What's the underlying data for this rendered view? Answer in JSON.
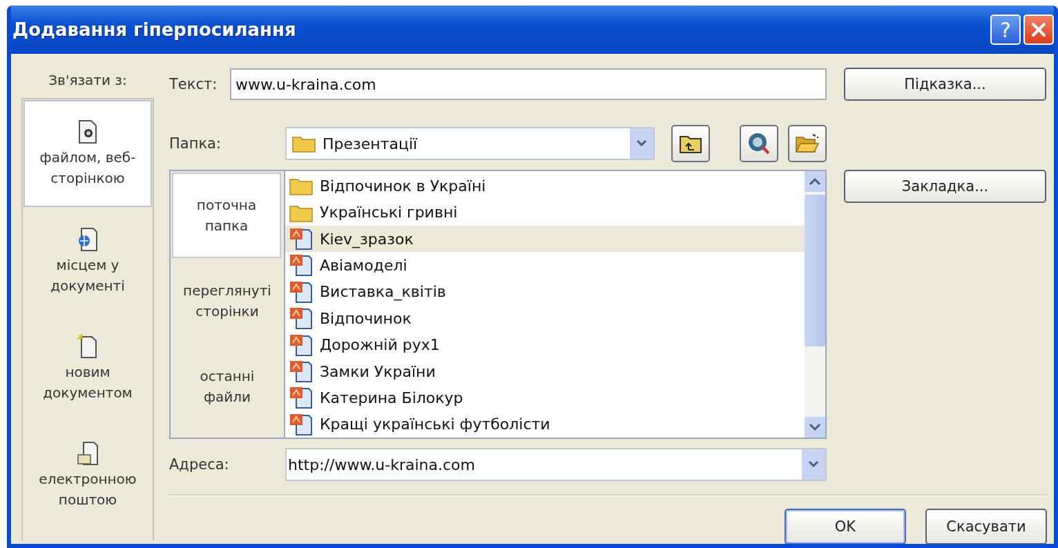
{
  "window": {
    "title": "Додавання гіперпосилання",
    "help": "?"
  },
  "link_to": {
    "label": "Зв'язати з:",
    "items": [
      {
        "label": "файлом, веб-сторінкою",
        "kind": "file",
        "selected": true
      },
      {
        "label": "місцем у документі",
        "kind": "place",
        "selected": false
      },
      {
        "label": "новим документом",
        "kind": "new",
        "selected": false
      },
      {
        "label": "електронною поштою",
        "kind": "email",
        "selected": false
      }
    ]
  },
  "text_field": {
    "label": "Текст:",
    "value": "www.u-kraina.com"
  },
  "folder": {
    "label": "Папка:",
    "value": "Презентації"
  },
  "browse_nav": [
    {
      "label": "поточна папка",
      "selected": true
    },
    {
      "label": "переглянуті сторінки",
      "selected": false
    },
    {
      "label": "останні файли",
      "selected": false
    }
  ],
  "files": [
    {
      "name": "Відпочинок в Україні",
      "kind": "folder",
      "selected": false
    },
    {
      "name": "Українські гривні",
      "kind": "folder",
      "selected": false
    },
    {
      "name": "Kiev_зразок",
      "kind": "presentation",
      "selected": true
    },
    {
      "name": "Авіамоделі",
      "kind": "presentation",
      "selected": false
    },
    {
      "name": "Виставка_квітів",
      "kind": "presentation",
      "selected": false
    },
    {
      "name": "Відпочинок",
      "kind": "presentation",
      "selected": false
    },
    {
      "name": "Дорожній рух1",
      "kind": "presentation",
      "selected": false
    },
    {
      "name": "Замки України",
      "kind": "presentation",
      "selected": false
    },
    {
      "name": "Катерина Білокур",
      "kind": "presentation",
      "selected": false
    },
    {
      "name": "Кращі українські футболісти",
      "kind": "presentation",
      "selected": false
    }
  ],
  "address": {
    "label": "Адреса:",
    "value": "http://www.u-kraina.com"
  },
  "side_buttons": [
    "Підказка...",
    "Закладка..."
  ],
  "buttons": [
    {
      "label": "OK",
      "default": true
    },
    {
      "label": "Скасувати",
      "default": false
    }
  ]
}
